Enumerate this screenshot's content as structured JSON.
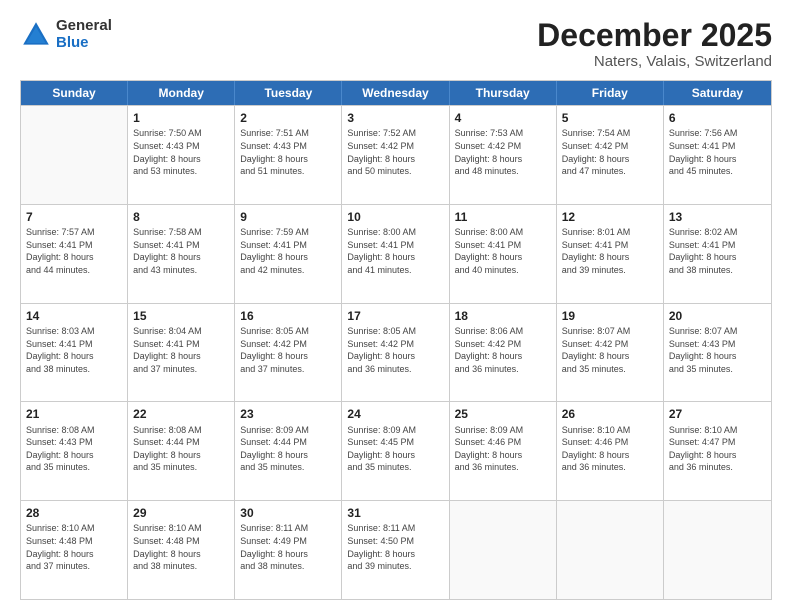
{
  "logo": {
    "general": "General",
    "blue": "Blue"
  },
  "title": "December 2025",
  "subtitle": "Naters, Valais, Switzerland",
  "header_days": [
    "Sunday",
    "Monday",
    "Tuesday",
    "Wednesday",
    "Thursday",
    "Friday",
    "Saturday"
  ],
  "weeks": [
    [
      {
        "day": "",
        "info": ""
      },
      {
        "day": "1",
        "info": "Sunrise: 7:50 AM\nSunset: 4:43 PM\nDaylight: 8 hours\nand 53 minutes."
      },
      {
        "day": "2",
        "info": "Sunrise: 7:51 AM\nSunset: 4:43 PM\nDaylight: 8 hours\nand 51 minutes."
      },
      {
        "day": "3",
        "info": "Sunrise: 7:52 AM\nSunset: 4:42 PM\nDaylight: 8 hours\nand 50 minutes."
      },
      {
        "day": "4",
        "info": "Sunrise: 7:53 AM\nSunset: 4:42 PM\nDaylight: 8 hours\nand 48 minutes."
      },
      {
        "day": "5",
        "info": "Sunrise: 7:54 AM\nSunset: 4:42 PM\nDaylight: 8 hours\nand 47 minutes."
      },
      {
        "day": "6",
        "info": "Sunrise: 7:56 AM\nSunset: 4:41 PM\nDaylight: 8 hours\nand 45 minutes."
      }
    ],
    [
      {
        "day": "7",
        "info": "Sunrise: 7:57 AM\nSunset: 4:41 PM\nDaylight: 8 hours\nand 44 minutes."
      },
      {
        "day": "8",
        "info": "Sunrise: 7:58 AM\nSunset: 4:41 PM\nDaylight: 8 hours\nand 43 minutes."
      },
      {
        "day": "9",
        "info": "Sunrise: 7:59 AM\nSunset: 4:41 PM\nDaylight: 8 hours\nand 42 minutes."
      },
      {
        "day": "10",
        "info": "Sunrise: 8:00 AM\nSunset: 4:41 PM\nDaylight: 8 hours\nand 41 minutes."
      },
      {
        "day": "11",
        "info": "Sunrise: 8:00 AM\nSunset: 4:41 PM\nDaylight: 8 hours\nand 40 minutes."
      },
      {
        "day": "12",
        "info": "Sunrise: 8:01 AM\nSunset: 4:41 PM\nDaylight: 8 hours\nand 39 minutes."
      },
      {
        "day": "13",
        "info": "Sunrise: 8:02 AM\nSunset: 4:41 PM\nDaylight: 8 hours\nand 38 minutes."
      }
    ],
    [
      {
        "day": "14",
        "info": "Sunrise: 8:03 AM\nSunset: 4:41 PM\nDaylight: 8 hours\nand 38 minutes."
      },
      {
        "day": "15",
        "info": "Sunrise: 8:04 AM\nSunset: 4:41 PM\nDaylight: 8 hours\nand 37 minutes."
      },
      {
        "day": "16",
        "info": "Sunrise: 8:05 AM\nSunset: 4:42 PM\nDaylight: 8 hours\nand 37 minutes."
      },
      {
        "day": "17",
        "info": "Sunrise: 8:05 AM\nSunset: 4:42 PM\nDaylight: 8 hours\nand 36 minutes."
      },
      {
        "day": "18",
        "info": "Sunrise: 8:06 AM\nSunset: 4:42 PM\nDaylight: 8 hours\nand 36 minutes."
      },
      {
        "day": "19",
        "info": "Sunrise: 8:07 AM\nSunset: 4:42 PM\nDaylight: 8 hours\nand 35 minutes."
      },
      {
        "day": "20",
        "info": "Sunrise: 8:07 AM\nSunset: 4:43 PM\nDaylight: 8 hours\nand 35 minutes."
      }
    ],
    [
      {
        "day": "21",
        "info": "Sunrise: 8:08 AM\nSunset: 4:43 PM\nDaylight: 8 hours\nand 35 minutes."
      },
      {
        "day": "22",
        "info": "Sunrise: 8:08 AM\nSunset: 4:44 PM\nDaylight: 8 hours\nand 35 minutes."
      },
      {
        "day": "23",
        "info": "Sunrise: 8:09 AM\nSunset: 4:44 PM\nDaylight: 8 hours\nand 35 minutes."
      },
      {
        "day": "24",
        "info": "Sunrise: 8:09 AM\nSunset: 4:45 PM\nDaylight: 8 hours\nand 35 minutes."
      },
      {
        "day": "25",
        "info": "Sunrise: 8:09 AM\nSunset: 4:46 PM\nDaylight: 8 hours\nand 36 minutes."
      },
      {
        "day": "26",
        "info": "Sunrise: 8:10 AM\nSunset: 4:46 PM\nDaylight: 8 hours\nand 36 minutes."
      },
      {
        "day": "27",
        "info": "Sunrise: 8:10 AM\nSunset: 4:47 PM\nDaylight: 8 hours\nand 36 minutes."
      }
    ],
    [
      {
        "day": "28",
        "info": "Sunrise: 8:10 AM\nSunset: 4:48 PM\nDaylight: 8 hours\nand 37 minutes."
      },
      {
        "day": "29",
        "info": "Sunrise: 8:10 AM\nSunset: 4:48 PM\nDaylight: 8 hours\nand 38 minutes."
      },
      {
        "day": "30",
        "info": "Sunrise: 8:11 AM\nSunset: 4:49 PM\nDaylight: 8 hours\nand 38 minutes."
      },
      {
        "day": "31",
        "info": "Sunrise: 8:11 AM\nSunset: 4:50 PM\nDaylight: 8 hours\nand 39 minutes."
      },
      {
        "day": "",
        "info": ""
      },
      {
        "day": "",
        "info": ""
      },
      {
        "day": "",
        "info": ""
      }
    ]
  ]
}
